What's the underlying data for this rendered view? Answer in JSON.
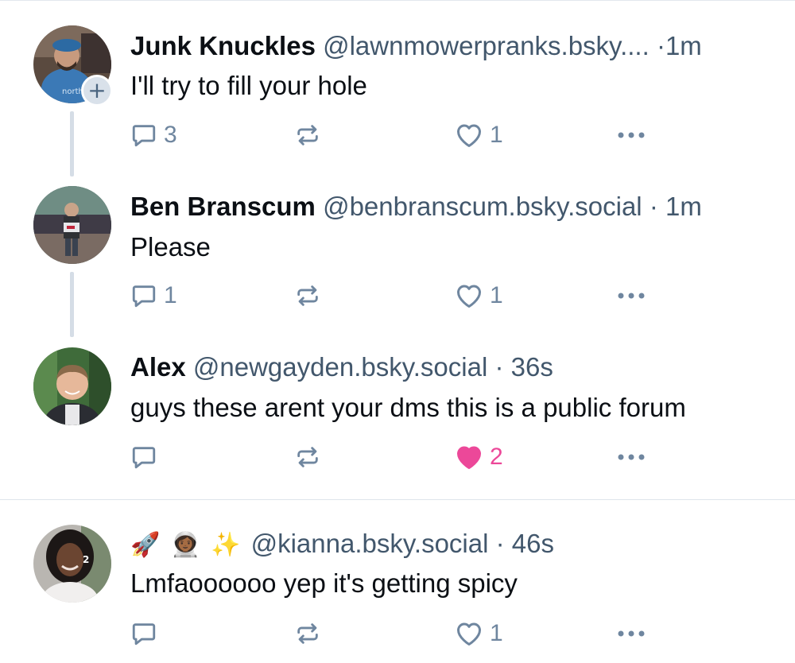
{
  "posts": [
    {
      "name": "Junk Knuckles",
      "handle": "@lawnmowerpranks.bsky....",
      "separator": "·",
      "time": "1m",
      "text": "I'll try to fill your hole",
      "reply_count": "3",
      "like_count": "1",
      "liked": false,
      "follow_badge": "+"
    },
    {
      "name": "Ben Branscum",
      "handle": "@benbranscum.bsky.social",
      "separator": "·",
      "time": "1m",
      "text": "Please",
      "reply_count": "1",
      "like_count": "1",
      "liked": false
    },
    {
      "name": "Alex",
      "handle": "@newgayden.bsky.social",
      "separator": "·",
      "time": "36s",
      "text": "guys these arent your dms this is a public forum",
      "reply_count": "",
      "like_count": "2",
      "liked": true
    },
    {
      "name_emoji": [
        "🚀",
        "👩🏾‍🚀",
        "✨"
      ],
      "handle": "@kianna.bsky.social",
      "separator": "·",
      "time": "46s",
      "text": "Lmfaoooooo yep it's getting spicy",
      "reply_count": "",
      "like_count": "1",
      "liked": false
    }
  ],
  "colors": {
    "text": "#0b0f14",
    "muted": "#42576c",
    "icon": "#6f869f",
    "liked": "#ec4899",
    "thread_line": "#d5dde6",
    "divider": "#dfe5eb"
  },
  "icons": {
    "reply": "reply-icon",
    "repost": "repost-icon",
    "like": "heart-icon",
    "more": "more-icon",
    "follow": "follow-plus-icon"
  }
}
